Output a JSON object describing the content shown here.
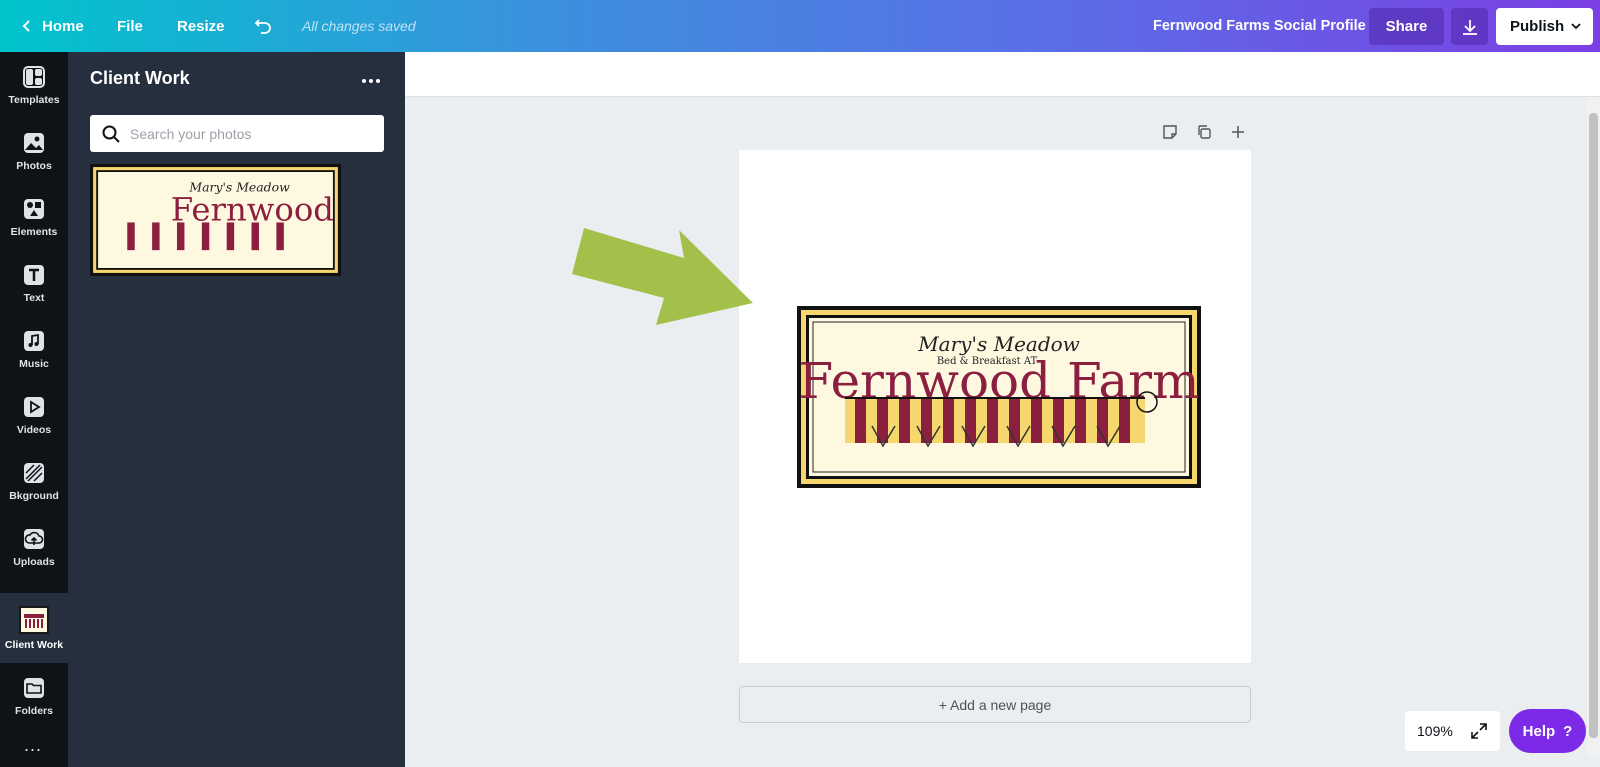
{
  "topbar": {
    "home_label": "Home",
    "file_label": "File",
    "resize_label": "Resize",
    "saved_status": "All changes saved",
    "design_title": "Fernwood Farms Social Profile",
    "share_label": "Share",
    "publish_label": "Publish"
  },
  "rail": {
    "items": [
      {
        "label": "Templates",
        "icon": "templates-icon"
      },
      {
        "label": "Photos",
        "icon": "photos-icon"
      },
      {
        "label": "Elements",
        "icon": "elements-icon"
      },
      {
        "label": "Text",
        "icon": "text-icon"
      },
      {
        "label": "Music",
        "icon": "music-icon"
      },
      {
        "label": "Videos",
        "icon": "videos-icon"
      },
      {
        "label": "Bkground",
        "icon": "background-icon"
      },
      {
        "label": "Uploads",
        "icon": "uploads-icon"
      },
      {
        "label": "Client Work",
        "icon": "client-work-thumbnail"
      },
      {
        "label": "Folders",
        "icon": "folders-icon"
      }
    ],
    "more": "..."
  },
  "panel": {
    "title": "Client Work",
    "search_placeholder": "Search your photos"
  },
  "logo": {
    "line1": "Mary's Meadow",
    "line2": "Bed & Breakfast AT",
    "line3": "Fernwood Farm"
  },
  "canvas": {
    "add_page_label": "+ Add a new page"
  },
  "footer": {
    "zoom": "109%",
    "help_label": "Help",
    "help_icon": "?"
  },
  "colors": {
    "accent_purple": "#7d2ae8",
    "arrow_green": "#a3c14a",
    "logo_red": "#8b1f3f",
    "logo_cream": "#fff8e1",
    "logo_yellow": "#f5d76e"
  }
}
